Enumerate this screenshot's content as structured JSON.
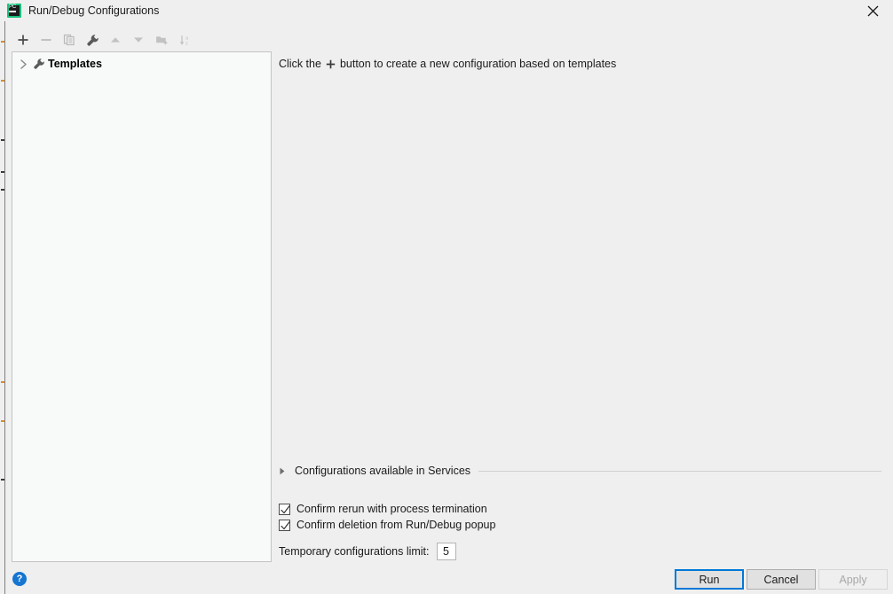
{
  "window": {
    "title": "Run/Debug Configurations",
    "app_icon": "pycharm-icon",
    "app_icon_text": "PC",
    "close_icon": "close-icon"
  },
  "toolbar": {
    "buttons": [
      {
        "name": "add-configuration-button",
        "icon": "plus-icon",
        "tooltip": "Add New Configuration",
        "enabled": true
      },
      {
        "name": "remove-configuration-button",
        "icon": "minus-icon",
        "tooltip": "Remove Configuration",
        "enabled": false
      },
      {
        "name": "copy-configuration-button",
        "icon": "copy-icon",
        "tooltip": "Copy Configuration",
        "enabled": false
      },
      {
        "name": "edit-templates-button",
        "icon": "wrench-icon",
        "tooltip": "Edit Templates",
        "enabled": true
      },
      {
        "name": "move-up-button",
        "icon": "arrow-up-icon",
        "tooltip": "Move Up",
        "enabled": false
      },
      {
        "name": "move-down-button",
        "icon": "arrow-down-icon",
        "tooltip": "Move Down",
        "enabled": false
      },
      {
        "name": "new-folder-button",
        "icon": "new-folder-icon",
        "tooltip": "Create New Folder",
        "enabled": false
      },
      {
        "name": "sort-alphabetically-button",
        "icon": "sort-az-icon",
        "tooltip": "Sort Configurations",
        "enabled": false
      }
    ]
  },
  "tree": {
    "items": [
      {
        "label": "Templates",
        "icon": "wrench-icon",
        "expander": "chevron-right-icon",
        "expanded": false,
        "bold": true
      }
    ]
  },
  "main": {
    "hint_prefix": "Click the",
    "hint_icon": "plus-icon",
    "hint_suffix": "button to create a new configuration based on templates",
    "services_section": {
      "label": "Configurations available in Services",
      "expander": "triangle-right-icon",
      "expanded": false
    },
    "checkboxes": [
      {
        "name": "confirm-rerun-checkbox",
        "label": "Confirm rerun with process termination",
        "checked": true
      },
      {
        "name": "confirm-deletion-checkbox",
        "label": "Confirm deletion from Run/Debug popup",
        "checked": true
      }
    ],
    "temporary_limit": {
      "label": "Temporary configurations limit:",
      "value": "5"
    }
  },
  "footer": {
    "help_icon": "question-mark-icon",
    "buttons": [
      {
        "name": "run-button",
        "label": "Run",
        "enabled": true,
        "focused": true
      },
      {
        "name": "cancel-button",
        "label": "Cancel",
        "enabled": true,
        "focused": false
      },
      {
        "name": "apply-button",
        "label": "Apply",
        "enabled": false,
        "focused": false
      }
    ]
  },
  "colors": {
    "dialog_bg": "#efefef",
    "tree_bg": "#f7faf8",
    "accent_focus": "#0078d7",
    "help_blue": "#1675d1",
    "brand_green": "#21d789",
    "border": "#c4c4c4",
    "disabled_text": "#a8a8a8"
  }
}
